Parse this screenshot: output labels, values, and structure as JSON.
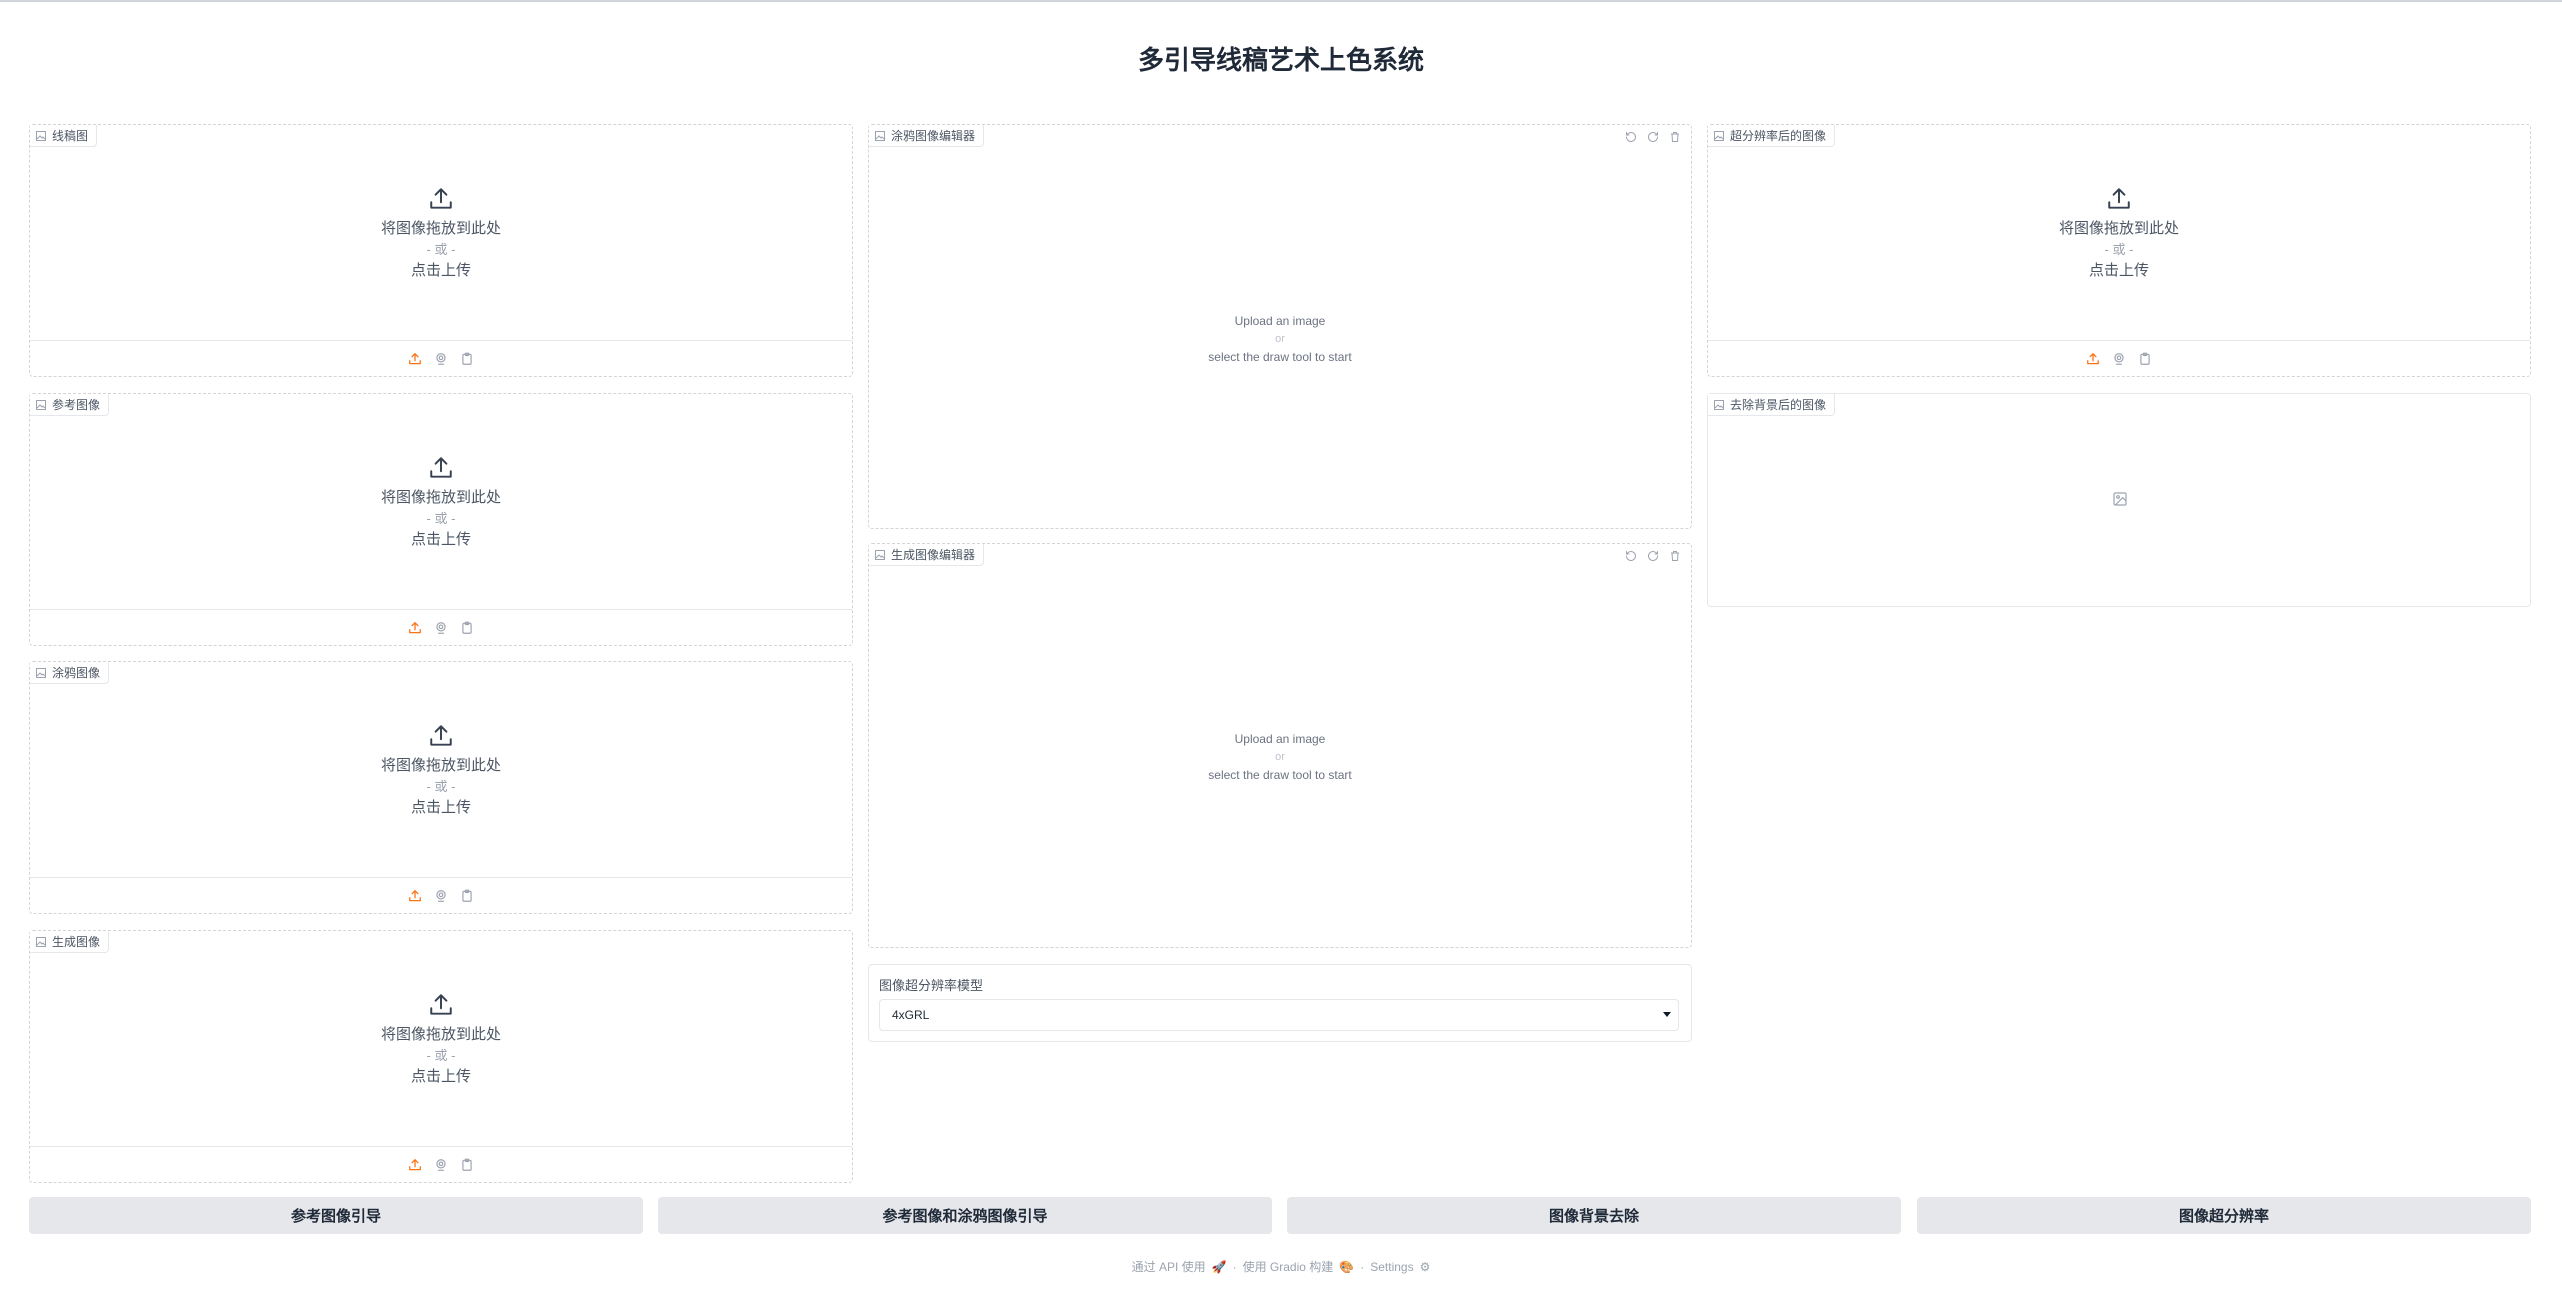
{
  "page": {
    "title": "多引导线稿艺术上色系统"
  },
  "upload_text": {
    "drop": "将图像拖放到此处",
    "or": "- 或 -",
    "click": "点击上传"
  },
  "editor_text": {
    "upload": "Upload an image",
    "or": "or",
    "draw": "select the draw tool to start"
  },
  "left_column": {
    "lineart": {
      "label": "线稿图"
    },
    "reference": {
      "label": "参考图像"
    },
    "scribble": {
      "label": "涂鸦图像"
    },
    "generated": {
      "label": "生成图像"
    }
  },
  "middle_column": {
    "scribble_editor": {
      "label": "涂鸦图像编辑器"
    },
    "generated_editor": {
      "label": "生成图像编辑器"
    },
    "sr_model": {
      "label": "图像超分辨率模型",
      "selected": "4xGRL"
    }
  },
  "right_column": {
    "sr_output": {
      "label": "超分辨率后的图像"
    },
    "bg_removed": {
      "label": "去除背景后的图像"
    }
  },
  "actions": {
    "ref_guide": "参考图像引导",
    "ref_scribble_guide": "参考图像和涂鸦图像引导",
    "bg_remove": "图像背景去除",
    "super_res": "图像超分辨率"
  },
  "footer": {
    "api": "通过 API 使用",
    "built": "使用 Gradio 构建",
    "settings": "Settings",
    "dot": "·"
  },
  "colors": {
    "accent": "#f97316",
    "button_bg": "#e5e7eb",
    "border": "#d4d4d8"
  },
  "icons": [
    "image-tag-icon",
    "upload-icon",
    "webcam-icon",
    "clipboard-icon",
    "undo-icon",
    "redo-icon",
    "trash-icon",
    "image-placeholder-icon",
    "rocket-icon",
    "gear-icon"
  ]
}
